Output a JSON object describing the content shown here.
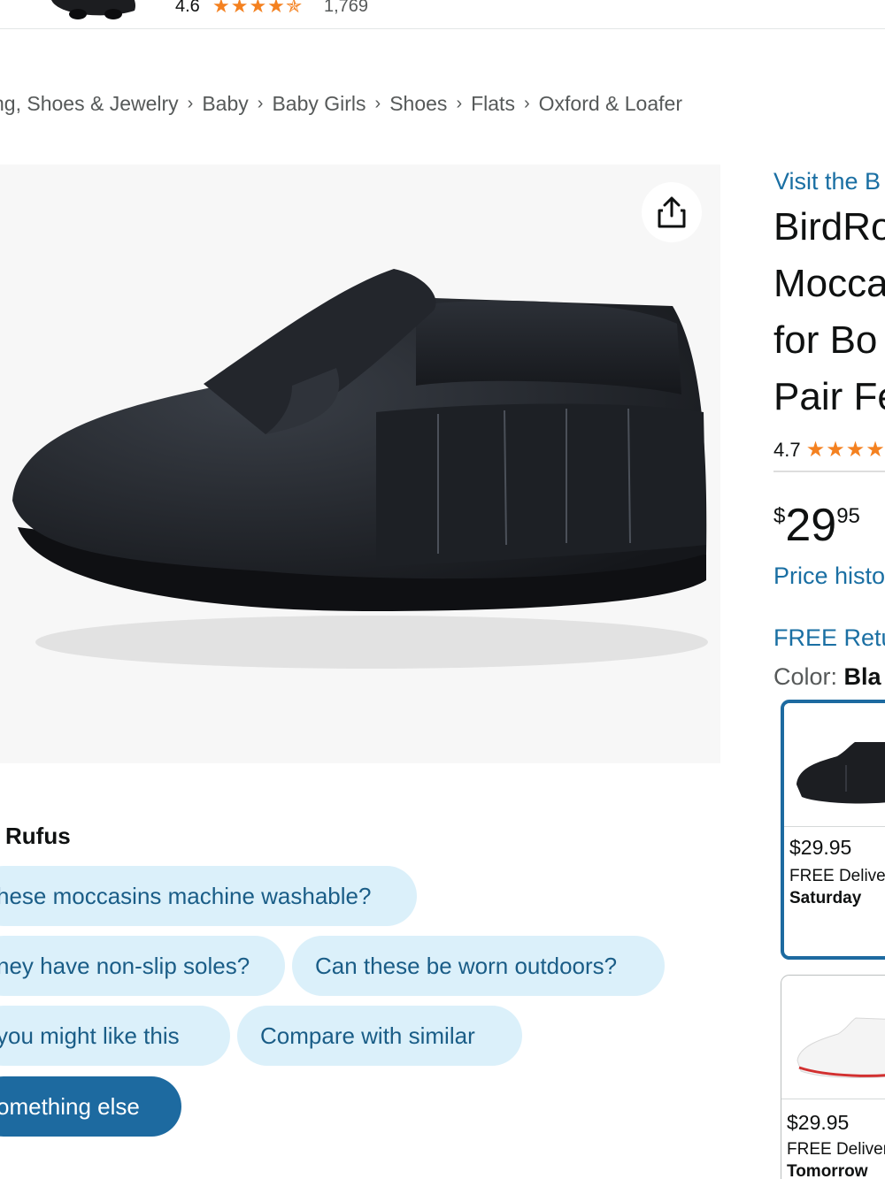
{
  "top_bar": {
    "rating": "4.6",
    "stars": "★★★★✯",
    "review_count": "1,769"
  },
  "breadcrumb": {
    "items": [
      "ng, Shoes & Jewelry",
      "Baby",
      "Baby Girls",
      "Shoes",
      "Flats",
      "Oxford & Loafer"
    ],
    "separator": "›"
  },
  "product_image": {
    "alt": "Black leather fringe moccasin",
    "share_icon": "share-icon"
  },
  "rufus": {
    "title": "Rufus",
    "suggestions": [
      "hese moccasins machine washable?",
      "ney have non-slip soles?",
      "Can these be worn outdoors?",
      "you might like this",
      "Compare with similar",
      "omething else"
    ]
  },
  "product": {
    "brand_link": "Visit the B",
    "title_lines": [
      "BirdRo",
      "Mocca",
      "for Bo",
      "Pair Fe"
    ],
    "rating": "4.7",
    "stars": "★★★★",
    "price_symbol": "$",
    "price_whole": "29",
    "price_fraction": "95",
    "price_history_link": "Price histo",
    "returns_link": "FREE Retu",
    "color_label": "Color:",
    "color_value": "Bla"
  },
  "swatches": [
    {
      "price": "$29.95",
      "delivery": "FREE Deliver",
      "day": "Saturday",
      "selected": true
    },
    {
      "price": "$29.95",
      "delivery": "FREE Deliver",
      "day": "Tomorrow",
      "selected": false
    }
  ],
  "colors": {
    "link": "#1a6fa3",
    "chip_bg": "#dbf0fa",
    "chip_dark_bg": "#1d6aa0",
    "star": "#f48120",
    "text": "#0f1111"
  }
}
